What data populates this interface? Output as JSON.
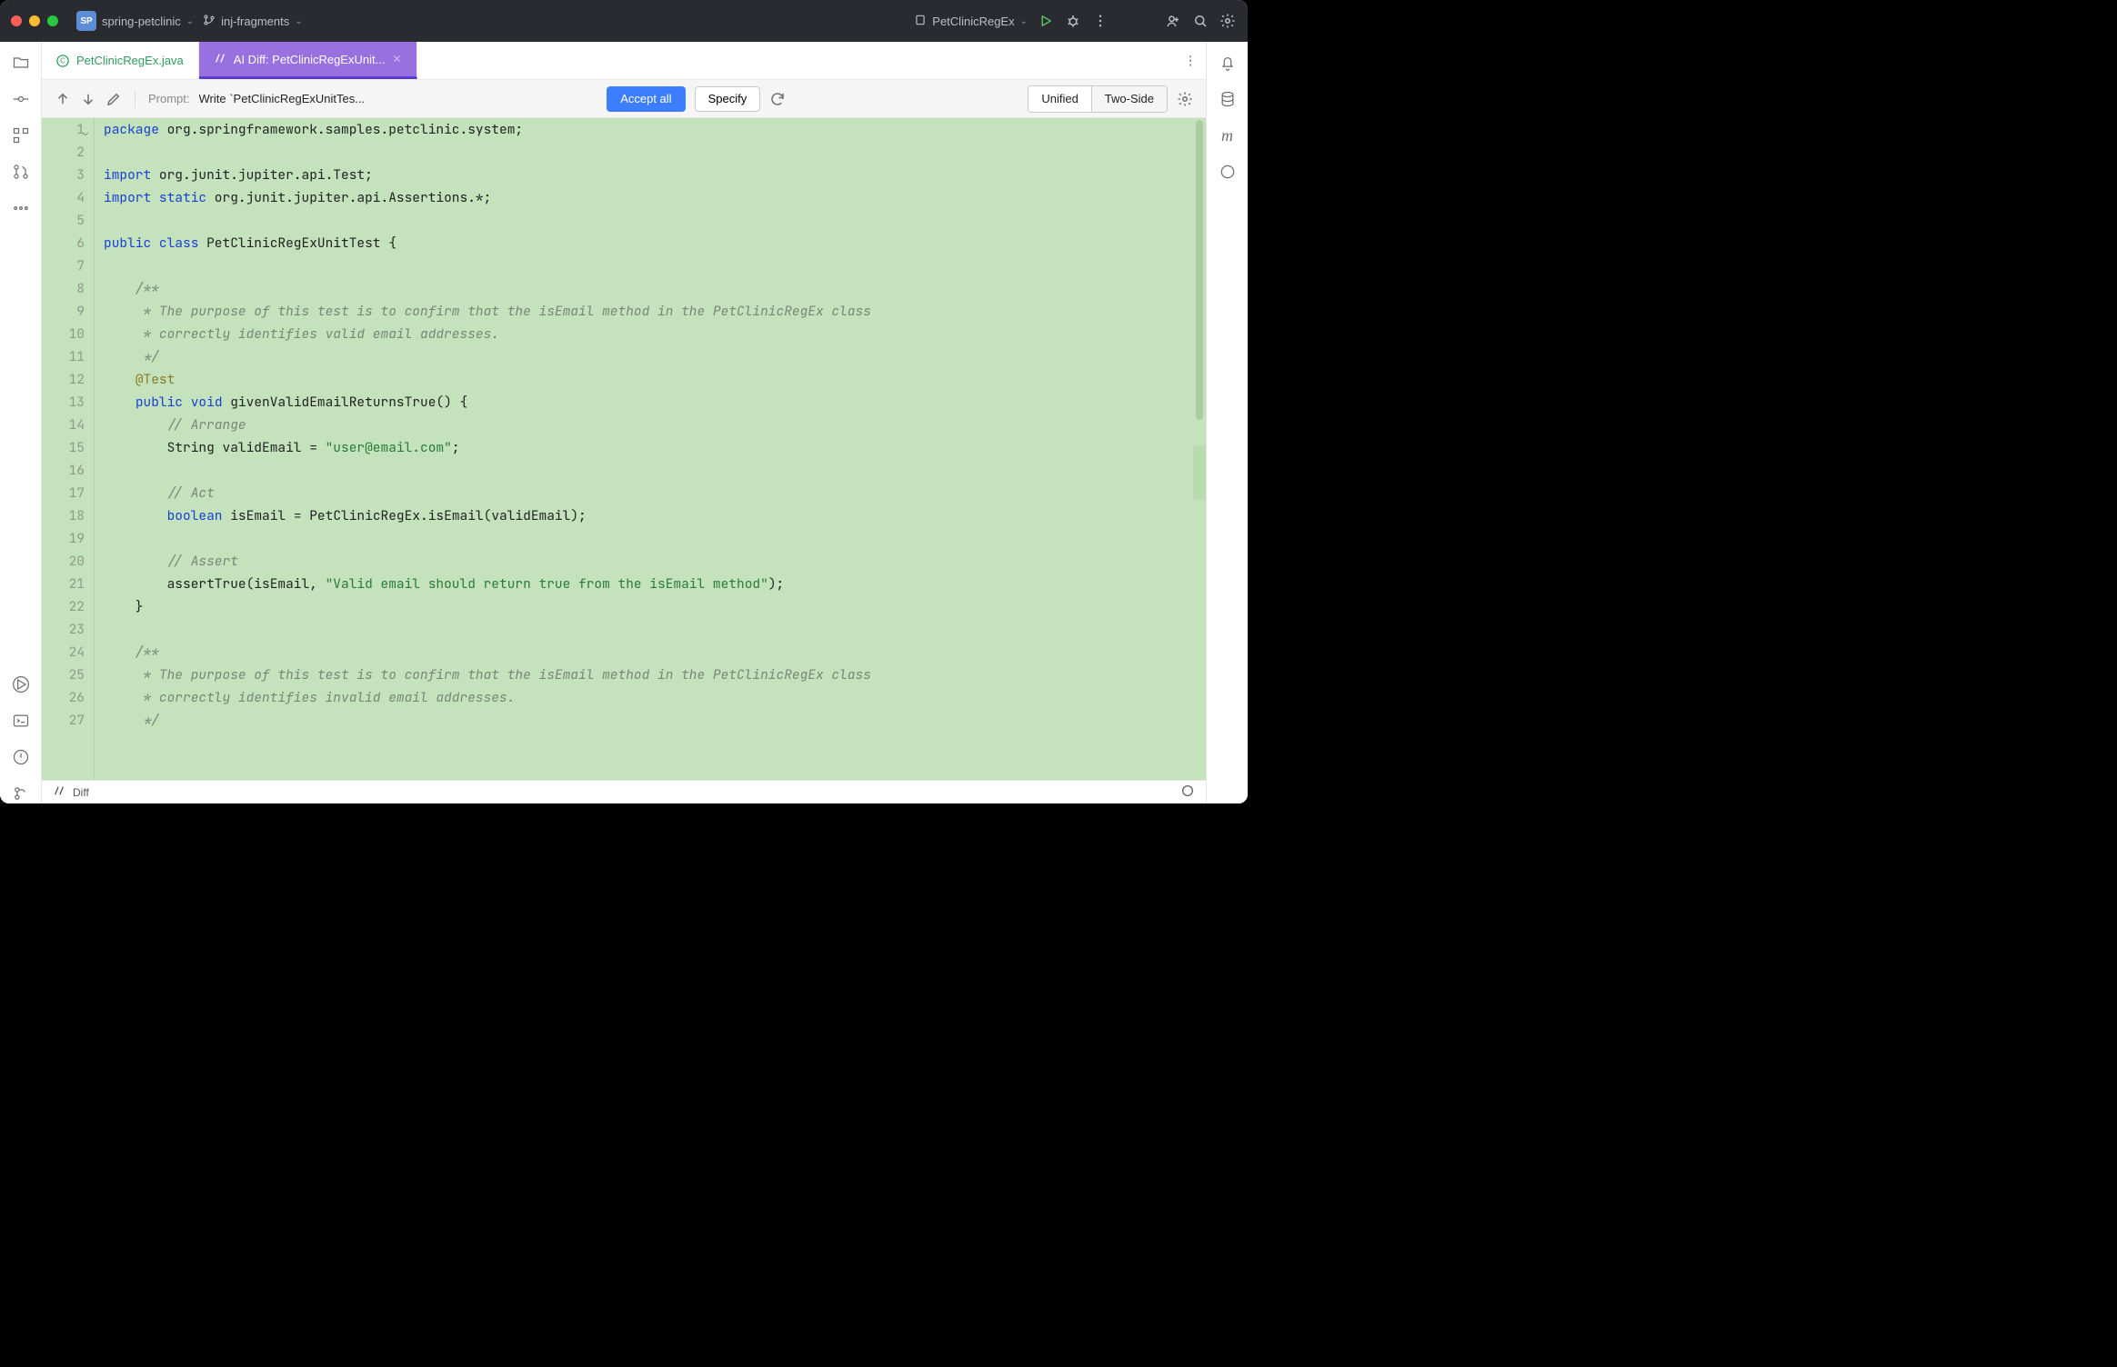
{
  "titlebar": {
    "project_badge": "SP",
    "project_name": "spring-petclinic",
    "branch": "inj-fragments",
    "run_config": "PetClinicRegEx"
  },
  "tabs": [
    {
      "label": "PetClinicRegEx.java",
      "kind": "java",
      "active": false
    },
    {
      "label": "AI Diff: PetClinicRegExUnit...",
      "kind": "ai-diff",
      "active": true
    }
  ],
  "diffbar": {
    "prompt_label": "Prompt:",
    "prompt_text": "Write `PetClinicRegExUnitTes...",
    "accept_all": "Accept all",
    "specify": "Specify",
    "view_modes": {
      "unified": "Unified",
      "two_side": "Two-Side"
    }
  },
  "code": {
    "lines": [
      {
        "n": 1,
        "fold": true,
        "tokens": [
          [
            "kw",
            "package"
          ],
          [
            "",
            " org.springframework.samples.petclinic.system;"
          ]
        ]
      },
      {
        "n": 2,
        "tokens": [
          [
            "",
            ""
          ]
        ]
      },
      {
        "n": 3,
        "tokens": [
          [
            "kw",
            "import"
          ],
          [
            "",
            " org.junit.jupiter.api.Test;"
          ]
        ]
      },
      {
        "n": 4,
        "tokens": [
          [
            "kw",
            "import"
          ],
          [
            "",
            " "
          ],
          [
            "kw",
            "static"
          ],
          [
            "",
            " org.junit.jupiter.api.Assertions.*;"
          ]
        ]
      },
      {
        "n": 5,
        "tokens": [
          [
            "",
            ""
          ]
        ]
      },
      {
        "n": 6,
        "tokens": [
          [
            "kw",
            "public"
          ],
          [
            "",
            " "
          ],
          [
            "kw",
            "class"
          ],
          [
            "",
            " PetClinicRegExUnitTest {"
          ]
        ]
      },
      {
        "n": 7,
        "tokens": [
          [
            "",
            ""
          ]
        ]
      },
      {
        "n": 8,
        "tokens": [
          [
            "",
            "    "
          ],
          [
            "cmt",
            "/**"
          ]
        ]
      },
      {
        "n": 9,
        "tokens": [
          [
            "",
            "     "
          ],
          [
            "cmt",
            "* The purpose of this test is to confirm that the isEmail method in the PetClinicRegEx class"
          ]
        ]
      },
      {
        "n": 10,
        "tokens": [
          [
            "",
            "     "
          ],
          [
            "cmt",
            "* correctly identifies valid email addresses."
          ]
        ]
      },
      {
        "n": 11,
        "tokens": [
          [
            "",
            "     "
          ],
          [
            "cmt",
            "*/"
          ]
        ]
      },
      {
        "n": 12,
        "tokens": [
          [
            "",
            "    "
          ],
          [
            "ann",
            "@Test"
          ]
        ]
      },
      {
        "n": 13,
        "tokens": [
          [
            "",
            "    "
          ],
          [
            "kw",
            "public"
          ],
          [
            "",
            " "
          ],
          [
            "kw",
            "void"
          ],
          [
            "",
            " givenValidEmailReturnsTrue() {"
          ]
        ]
      },
      {
        "n": 14,
        "tokens": [
          [
            "",
            "        "
          ],
          [
            "cmt",
            "// Arrange"
          ]
        ]
      },
      {
        "n": 15,
        "tokens": [
          [
            "",
            "        String validEmail = "
          ],
          [
            "str",
            "\"user@email.com\""
          ],
          [
            "",
            ";"
          ]
        ]
      },
      {
        "n": 16,
        "tokens": [
          [
            "",
            ""
          ]
        ]
      },
      {
        "n": 17,
        "tokens": [
          [
            "",
            "        "
          ],
          [
            "cmt",
            "// Act"
          ]
        ]
      },
      {
        "n": 18,
        "tokens": [
          [
            "",
            "        "
          ],
          [
            "kw",
            "boolean"
          ],
          [
            "",
            " isEmail = PetClinicRegEx.isEmail(validEmail);"
          ]
        ]
      },
      {
        "n": 19,
        "tokens": [
          [
            "",
            ""
          ]
        ]
      },
      {
        "n": 20,
        "tokens": [
          [
            "",
            "        "
          ],
          [
            "cmt",
            "// Assert"
          ]
        ]
      },
      {
        "n": 21,
        "tokens": [
          [
            "",
            "        assertTrue(isEmail, "
          ],
          [
            "str",
            "\"Valid email should return true from the isEmail method\""
          ],
          [
            "",
            ");"
          ]
        ]
      },
      {
        "n": 22,
        "tokens": [
          [
            "",
            "    }"
          ]
        ]
      },
      {
        "n": 23,
        "tokens": [
          [
            "",
            ""
          ]
        ]
      },
      {
        "n": 24,
        "tokens": [
          [
            "",
            "    "
          ],
          [
            "cmt",
            "/**"
          ]
        ]
      },
      {
        "n": 25,
        "tokens": [
          [
            "",
            "     "
          ],
          [
            "cmt",
            "* The purpose of this test is to confirm that the isEmail method in the PetClinicRegEx class"
          ]
        ]
      },
      {
        "n": 26,
        "tokens": [
          [
            "",
            "     "
          ],
          [
            "cmt",
            "* correctly identifies invalid email addresses."
          ]
        ]
      },
      {
        "n": 27,
        "tokens": [
          [
            "",
            "     "
          ],
          [
            "cmt",
            "*/"
          ]
        ]
      }
    ]
  },
  "status": {
    "label": "Diff"
  }
}
